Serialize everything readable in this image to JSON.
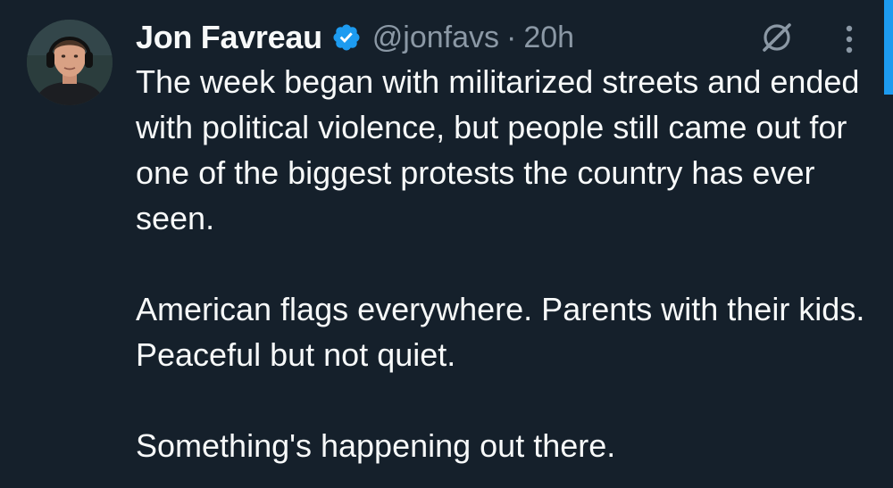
{
  "author": {
    "display_name": "Jon Favreau",
    "handle": "@jonfavs",
    "separator": "·",
    "timestamp": "20h",
    "verified": true,
    "verified_color": "#1d9bf0"
  },
  "icons": {
    "verified": "verified-badge-icon",
    "grok": "grok-icon",
    "more": "more-options-icon"
  },
  "tweet": {
    "paragraphs": [
      "The week began with militarized streets and ended with political violence, but people still came out for one of the biggest protests the country has ever seen.",
      "American flags everywhere. Parents with their kids. Peaceful but not quiet.",
      "Something's happening out there."
    ]
  },
  "colors": {
    "background": "#15202b",
    "text_primary": "#f7f9f9",
    "text_secondary": "#8b98a5",
    "accent": "#1d9bf0"
  }
}
